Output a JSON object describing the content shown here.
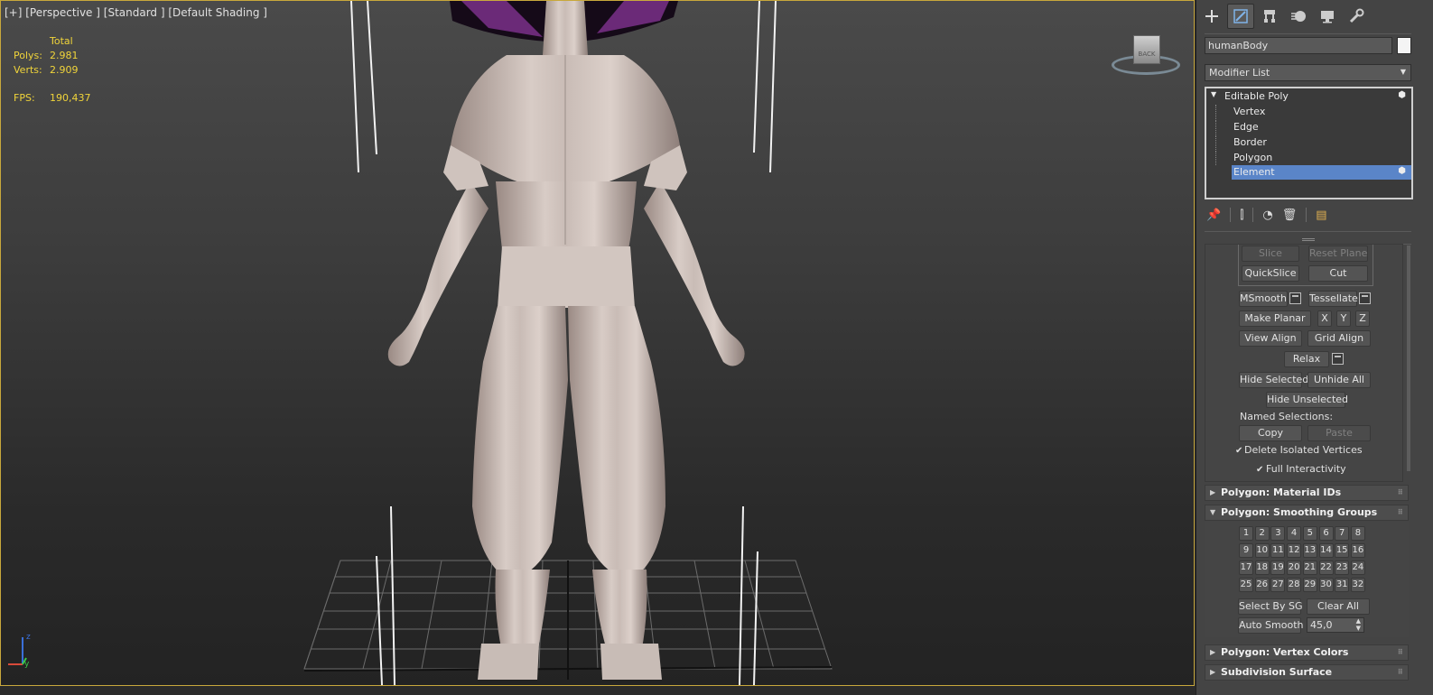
{
  "viewport": {
    "label_parts": [
      "[+]",
      "[Perspective ]",
      "[Standard ]",
      "[Default Shading ]"
    ],
    "stats": {
      "total_label": "Total",
      "polys_label": "Polys:",
      "polys_value": "2.981",
      "verts_label": "Verts:",
      "verts_value": "2.909",
      "fps_label": "FPS:",
      "fps_value": "190,437"
    },
    "viewcube_label": "BACK",
    "axis": {
      "x": "x",
      "y": "y",
      "z": "z"
    }
  },
  "command_panel": {
    "tabs": [
      "create-icon",
      "modify-icon",
      "hierarchy-icon",
      "motion-icon",
      "display-icon",
      "utilities-icon"
    ],
    "object_name": "humanBody",
    "object_color": "#f4f4f4",
    "modifier_list_label": "Modifier List",
    "stack": {
      "root": "Editable Poly",
      "subobjects": [
        "Vertex",
        "Edge",
        "Border",
        "Polygon",
        "Element"
      ],
      "selected": "Element",
      "selection_color": "#5a85c8"
    },
    "edit_geometry": {
      "slice": "Slice",
      "reset_plane": "Reset Plane",
      "quickslice": "QuickSlice",
      "cut": "Cut",
      "msmooth": "MSmooth",
      "tessellate": "Tessellate",
      "make_planar": "Make Planar",
      "x": "X",
      "y": "Y",
      "z": "Z",
      "view_align": "View Align",
      "grid_align": "Grid Align",
      "relax": "Relax",
      "hide_selected": "Hide Selected",
      "unhide_all": "Unhide All",
      "hide_unselected": "Hide Unselected",
      "named_selections": "Named Selections:",
      "copy": "Copy",
      "paste": "Paste",
      "delete_isolated": "Delete Isolated Vertices",
      "full_interactivity": "Full Interactivity"
    },
    "rollouts": {
      "material_ids": "Polygon: Material IDs",
      "smoothing_groups": "Polygon: Smoothing Groups",
      "vertex_colors": "Polygon: Vertex Colors",
      "subdivision_surface": "Subdivision Surface"
    },
    "smoothing": {
      "groups": [
        "1",
        "2",
        "3",
        "4",
        "5",
        "6",
        "7",
        "8",
        "9",
        "10",
        "11",
        "12",
        "13",
        "14",
        "15",
        "16",
        "17",
        "18",
        "19",
        "20",
        "21",
        "22",
        "23",
        "24",
        "25",
        "26",
        "27",
        "28",
        "29",
        "30",
        "31",
        "32"
      ],
      "select_by_sg": "Select By SG",
      "clear_all": "Clear All",
      "auto_smooth": "Auto Smooth",
      "threshold": "45,0"
    }
  }
}
